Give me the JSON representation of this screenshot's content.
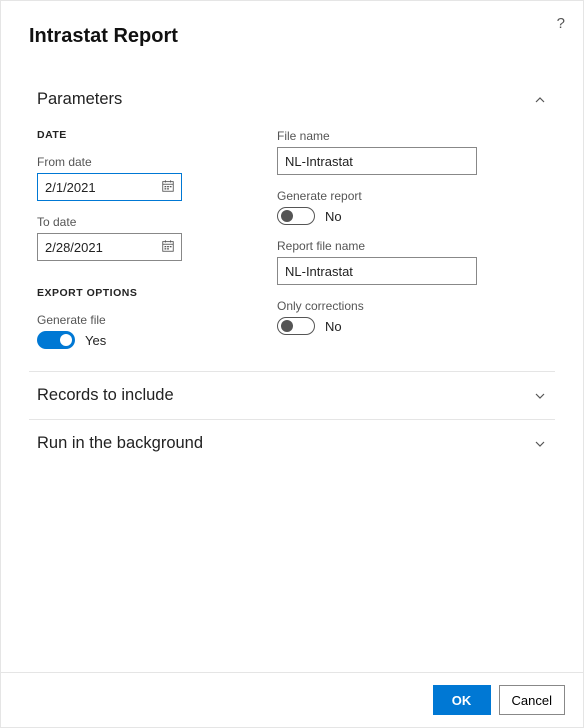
{
  "dialogTitle": "Intrastat Report",
  "sections": {
    "parameters": {
      "title": "Parameters"
    },
    "records": {
      "title": "Records to include"
    },
    "background": {
      "title": "Run in the background"
    }
  },
  "groups": {
    "date": "DATE",
    "exportOptions": "EXPORT OPTIONS"
  },
  "fields": {
    "fromDate": {
      "label": "From date",
      "value": "2/1/2021"
    },
    "toDate": {
      "label": "To date",
      "value": "2/28/2021"
    },
    "generateFile": {
      "label": "Generate file",
      "valueText": "Yes"
    },
    "fileName": {
      "label": "File name",
      "value": "NL-Intrastat"
    },
    "generateReport": {
      "label": "Generate report",
      "valueText": "No"
    },
    "reportFileName": {
      "label": "Report file name",
      "value": "NL-Intrastat"
    },
    "onlyCorrections": {
      "label": "Only corrections",
      "valueText": "No"
    }
  },
  "buttons": {
    "ok": "OK",
    "cancel": "Cancel"
  }
}
